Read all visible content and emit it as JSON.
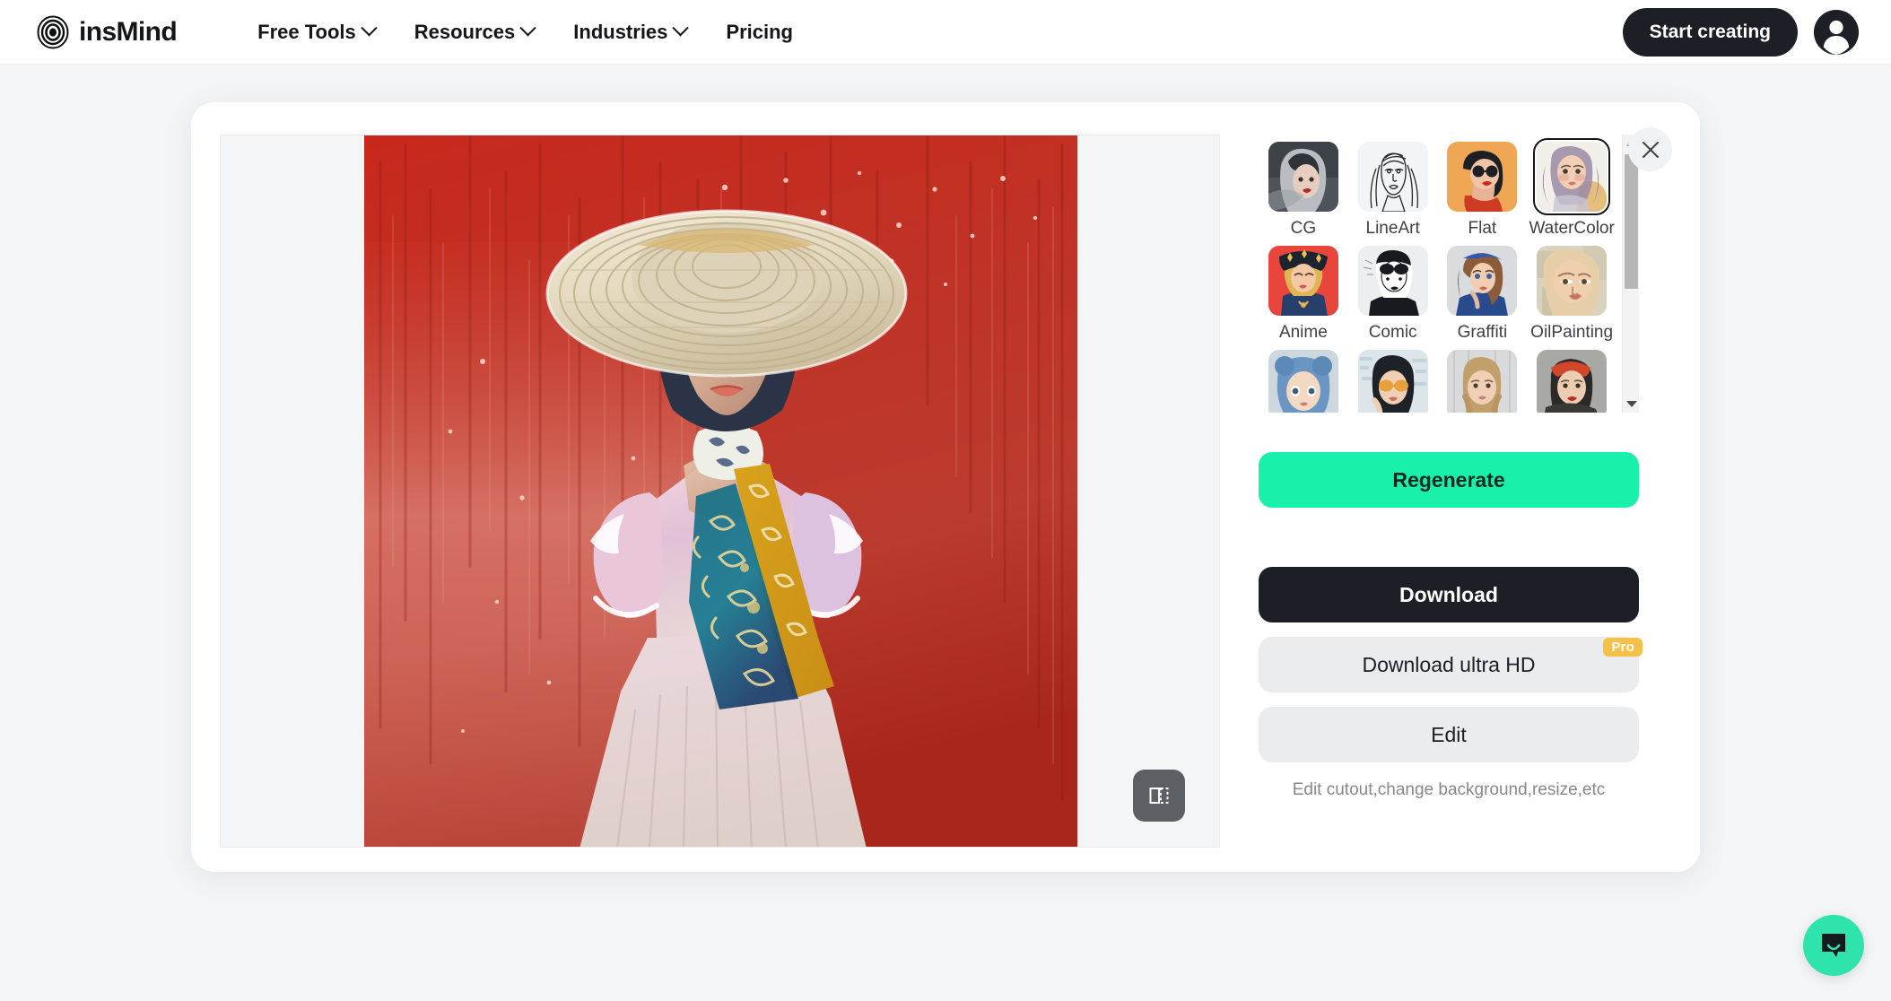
{
  "navbar": {
    "brand": "insMind",
    "brand_icon": "concentric-rings-logo",
    "links": [
      {
        "label": "Free Tools",
        "has_dropdown": true
      },
      {
        "label": "Resources",
        "has_dropdown": true
      },
      {
        "label": "Industries",
        "has_dropdown": true
      },
      {
        "label": "Pricing",
        "has_dropdown": false
      }
    ],
    "start_button": "Start creating",
    "avatar_icon": "user-avatar-icon"
  },
  "modal": {
    "close_icon": "close-icon",
    "preview": {
      "compare_icon": "compare-split-icon",
      "artwork_alt": "watercolor portrait of woman in straw hat and pink dress on red background"
    },
    "styles": {
      "selected": "WaterColor",
      "items": [
        {
          "label": "CG",
          "selected": false
        },
        {
          "label": "LineArt",
          "selected": false
        },
        {
          "label": "Flat",
          "selected": false
        },
        {
          "label": "WaterColor",
          "selected": true
        },
        {
          "label": "Anime",
          "selected": false
        },
        {
          "label": "Comic",
          "selected": false
        },
        {
          "label": "Graffiti",
          "selected": false
        },
        {
          "label": "OilPainting",
          "selected": false
        },
        {
          "label": "",
          "selected": false
        },
        {
          "label": "",
          "selected": false
        },
        {
          "label": "",
          "selected": false
        },
        {
          "label": "",
          "selected": false
        }
      ],
      "scrollbar": {
        "up_icon": "chevron-up-icon",
        "down_icon": "chevron-down-icon"
      }
    },
    "actions": {
      "regenerate": "Regenerate",
      "download": "Download",
      "download_ultra": "Download ultra HD",
      "pro_badge": "Pro",
      "edit": "Edit",
      "edit_hint": "Edit cutout,change background,resize,etc"
    }
  },
  "chat": {
    "icon": "chat-bubble-icon"
  },
  "colors": {
    "accent_green": "#19f0ac",
    "chat_green": "#2fe3ad",
    "dark": "#1c1f26",
    "pro_amber": "#f6c14b",
    "page_bg": "#f4f5f7"
  }
}
